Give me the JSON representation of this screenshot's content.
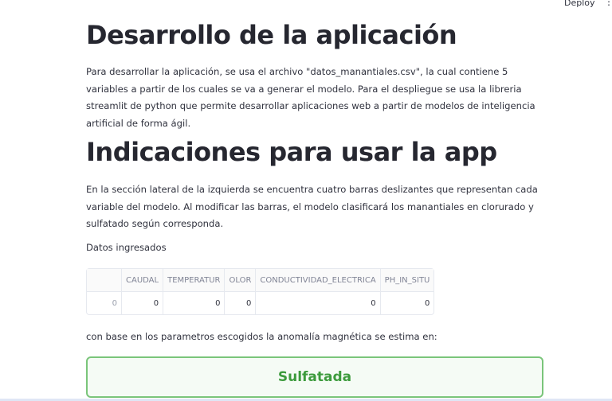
{
  "header": {
    "deploy_label": "Deploy",
    "menu_icon": "vertical-ellipsis-icon"
  },
  "section1": {
    "title": "Desarrollo de la aplicación",
    "paragraph": "Para desarrollar la aplicación, se usa el archivo \"datos_manantiales.csv\", la cual contiene 5 variables a partir de los cuales se va a generar el modelo. Para el despliegue se usa la libreria streamlit de python que permite desarrollar aplicaciones web a partir de modelos de inteligencia artificial de forma ágil."
  },
  "section2": {
    "title": "Indicaciones para usar la app",
    "paragraph": "En la sección lateral de la izquierda se encuentra cuatro barras deslizantes que representan cada variable del modelo. Al modificar las barras, el modelo clasificará los manantiales en clorurado y sulfatado según corresponda."
  },
  "data_label": "Datos ingresados",
  "table": {
    "columns": [
      "",
      "CAUDAL",
      "TEMPERATUR",
      "OLOR",
      "CONDUCTIVIDAD_ELECTRICA",
      "PH_IN_SITU"
    ],
    "rows": [
      [
        "0",
        "0",
        "0",
        "0",
        "0",
        "0"
      ]
    ]
  },
  "result_label": "con base en los parametros escogidos la anomalía magnética se estima en:",
  "result_value": "Sulfatada",
  "colors": {
    "success_border": "#7ac57a",
    "success_text": "#3d9b3d"
  }
}
